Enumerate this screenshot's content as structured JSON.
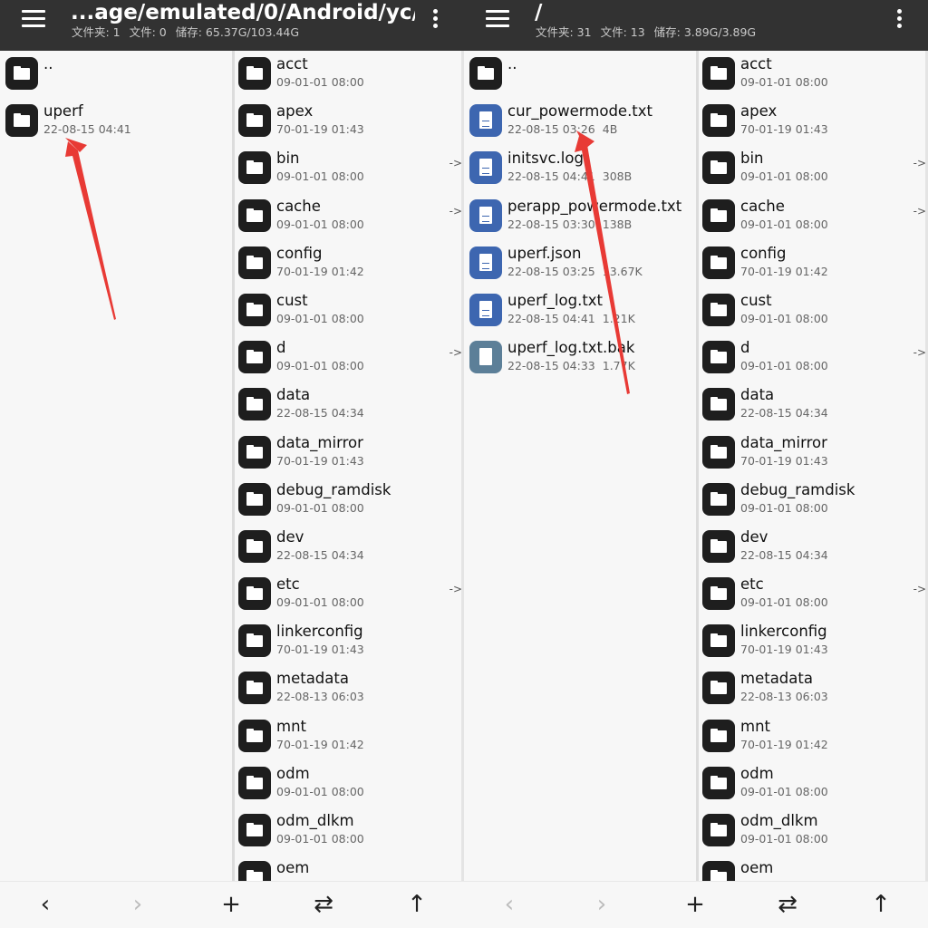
{
  "screens": [
    {
      "path": "...age/emulated/0/Android/yc/",
      "stats": {
        "folders": "文件夹: 1",
        "files": "文件: 0",
        "storage": "储存: 65.37G/103.44G"
      },
      "pane_a": [
        {
          "name": "..",
          "type": "folder",
          "date": "",
          "size": ""
        },
        {
          "name": "uperf",
          "type": "folder",
          "date": "22-08-15 04:41",
          "size": ""
        }
      ],
      "pane_b": [
        {
          "name": "acct",
          "type": "folder",
          "date": "09-01-01 08:00",
          "size": "",
          "link": ""
        },
        {
          "name": "apex",
          "type": "folder",
          "date": "70-01-19 01:43",
          "size": "",
          "link": ""
        },
        {
          "name": "bin",
          "type": "folder",
          "date": "09-01-01 08:00",
          "size": "",
          "link": "->"
        },
        {
          "name": "cache",
          "type": "folder",
          "date": "09-01-01 08:00",
          "size": "",
          "link": "->"
        },
        {
          "name": "config",
          "type": "folder",
          "date": "70-01-19 01:42",
          "size": "",
          "link": ""
        },
        {
          "name": "cust",
          "type": "folder",
          "date": "09-01-01 08:00",
          "size": "",
          "link": ""
        },
        {
          "name": "d",
          "type": "folder",
          "date": "09-01-01 08:00",
          "size": "",
          "link": "->"
        },
        {
          "name": "data",
          "type": "folder",
          "date": "22-08-15 04:34",
          "size": "",
          "link": ""
        },
        {
          "name": "data_mirror",
          "type": "folder",
          "date": "70-01-19 01:43",
          "size": "",
          "link": ""
        },
        {
          "name": "debug_ramdisk",
          "type": "folder",
          "date": "09-01-01 08:00",
          "size": "",
          "link": ""
        },
        {
          "name": "dev",
          "type": "folder",
          "date": "22-08-15 04:34",
          "size": "",
          "link": ""
        },
        {
          "name": "etc",
          "type": "folder",
          "date": "09-01-01 08:00",
          "size": "",
          "link": "->"
        },
        {
          "name": "linkerconfig",
          "type": "folder",
          "date": "70-01-19 01:43",
          "size": "",
          "link": ""
        },
        {
          "name": "metadata",
          "type": "folder",
          "date": "22-08-13 06:03",
          "size": "",
          "link": ""
        },
        {
          "name": "mnt",
          "type": "folder",
          "date": "70-01-19 01:42",
          "size": "",
          "link": ""
        },
        {
          "name": "odm",
          "type": "folder",
          "date": "09-01-01 08:00",
          "size": "",
          "link": ""
        },
        {
          "name": "odm_dlkm",
          "type": "folder",
          "date": "09-01-01 08:00",
          "size": "",
          "link": ""
        },
        {
          "name": "oem",
          "type": "folder",
          "date": "",
          "size": "",
          "link": ""
        }
      ],
      "buttons": [
        {
          "name": "back-button",
          "glyph": "‹",
          "disabled": false
        },
        {
          "name": "forward-button",
          "glyph": "›",
          "disabled": true
        },
        {
          "name": "add-button",
          "glyph": "+",
          "disabled": false
        },
        {
          "name": "swap-button",
          "glyph": "⇄",
          "disabled": false
        },
        {
          "name": "up-button",
          "glyph": "↑",
          "disabled": false
        }
      ]
    },
    {
      "path": "/",
      "stats": {
        "folders": "文件夹: 31",
        "files": "文件: 13",
        "storage": "储存: 3.89G/3.89G"
      },
      "pane_a": [
        {
          "name": "..",
          "type": "folder",
          "date": "",
          "size": ""
        },
        {
          "name": "cur_powermode.txt",
          "type": "file",
          "date": "22-08-15 03:26",
          "size": "4B"
        },
        {
          "name": "initsvc.log",
          "type": "file",
          "date": "22-08-15 04:41",
          "size": "308B"
        },
        {
          "name": "perapp_powermode.txt",
          "type": "file",
          "date": "22-08-15 03:30",
          "size": "138B"
        },
        {
          "name": "uperf.json",
          "type": "file",
          "date": "22-08-15 03:25",
          "size": "13.67K"
        },
        {
          "name": "uperf_log.txt",
          "type": "file",
          "date": "22-08-15 04:41",
          "size": "1.21K"
        },
        {
          "name": "uperf_log.txt.bak",
          "type": "bak",
          "date": "22-08-15 04:33",
          "size": "1.77K"
        }
      ],
      "pane_b": [
        {
          "name": "acct",
          "type": "folder",
          "date": "09-01-01 08:00",
          "size": "",
          "link": ""
        },
        {
          "name": "apex",
          "type": "folder",
          "date": "70-01-19 01:43",
          "size": "",
          "link": ""
        },
        {
          "name": "bin",
          "type": "folder",
          "date": "09-01-01 08:00",
          "size": "",
          "link": "->"
        },
        {
          "name": "cache",
          "type": "folder",
          "date": "09-01-01 08:00",
          "size": "",
          "link": "->"
        },
        {
          "name": "config",
          "type": "folder",
          "date": "70-01-19 01:42",
          "size": "",
          "link": ""
        },
        {
          "name": "cust",
          "type": "folder",
          "date": "09-01-01 08:00",
          "size": "",
          "link": ""
        },
        {
          "name": "d",
          "type": "folder",
          "date": "09-01-01 08:00",
          "size": "",
          "link": "->"
        },
        {
          "name": "data",
          "type": "folder",
          "date": "22-08-15 04:34",
          "size": "",
          "link": ""
        },
        {
          "name": "data_mirror",
          "type": "folder",
          "date": "70-01-19 01:43",
          "size": "",
          "link": ""
        },
        {
          "name": "debug_ramdisk",
          "type": "folder",
          "date": "09-01-01 08:00",
          "size": "",
          "link": ""
        },
        {
          "name": "dev",
          "type": "folder",
          "date": "22-08-15 04:34",
          "size": "",
          "link": ""
        },
        {
          "name": "etc",
          "type": "folder",
          "date": "09-01-01 08:00",
          "size": "",
          "link": "->"
        },
        {
          "name": "linkerconfig",
          "type": "folder",
          "date": "70-01-19 01:43",
          "size": "",
          "link": ""
        },
        {
          "name": "metadata",
          "type": "folder",
          "date": "22-08-13 06:03",
          "size": "",
          "link": ""
        },
        {
          "name": "mnt",
          "type": "folder",
          "date": "70-01-19 01:42",
          "size": "",
          "link": ""
        },
        {
          "name": "odm",
          "type": "folder",
          "date": "09-01-01 08:00",
          "size": "",
          "link": ""
        },
        {
          "name": "odm_dlkm",
          "type": "folder",
          "date": "09-01-01 08:00",
          "size": "",
          "link": ""
        },
        {
          "name": "oem",
          "type": "folder",
          "date": "",
          "size": "",
          "link": ""
        }
      ],
      "buttons": [
        {
          "name": "back-button",
          "glyph": "‹",
          "disabled": true
        },
        {
          "name": "forward-button",
          "glyph": "›",
          "disabled": true
        },
        {
          "name": "add-button",
          "glyph": "+",
          "disabled": false
        },
        {
          "name": "swap-button",
          "glyph": "⇄",
          "disabled": false
        },
        {
          "name": "up-button",
          "glyph": "↑",
          "disabled": false
        }
      ]
    }
  ],
  "colors": {
    "topbar": "#323232",
    "folder_icon": "#1e1e1e",
    "file_icon": "#3d66b0",
    "bak_icon": "#5c7f98",
    "annotation_arrow": "#e83a35"
  },
  "icons": [
    "menu-icon",
    "more-vert-icon",
    "folder-icon",
    "file-icon",
    "back-icon",
    "forward-icon",
    "add-icon",
    "swap-icon",
    "up-arrow-icon"
  ]
}
